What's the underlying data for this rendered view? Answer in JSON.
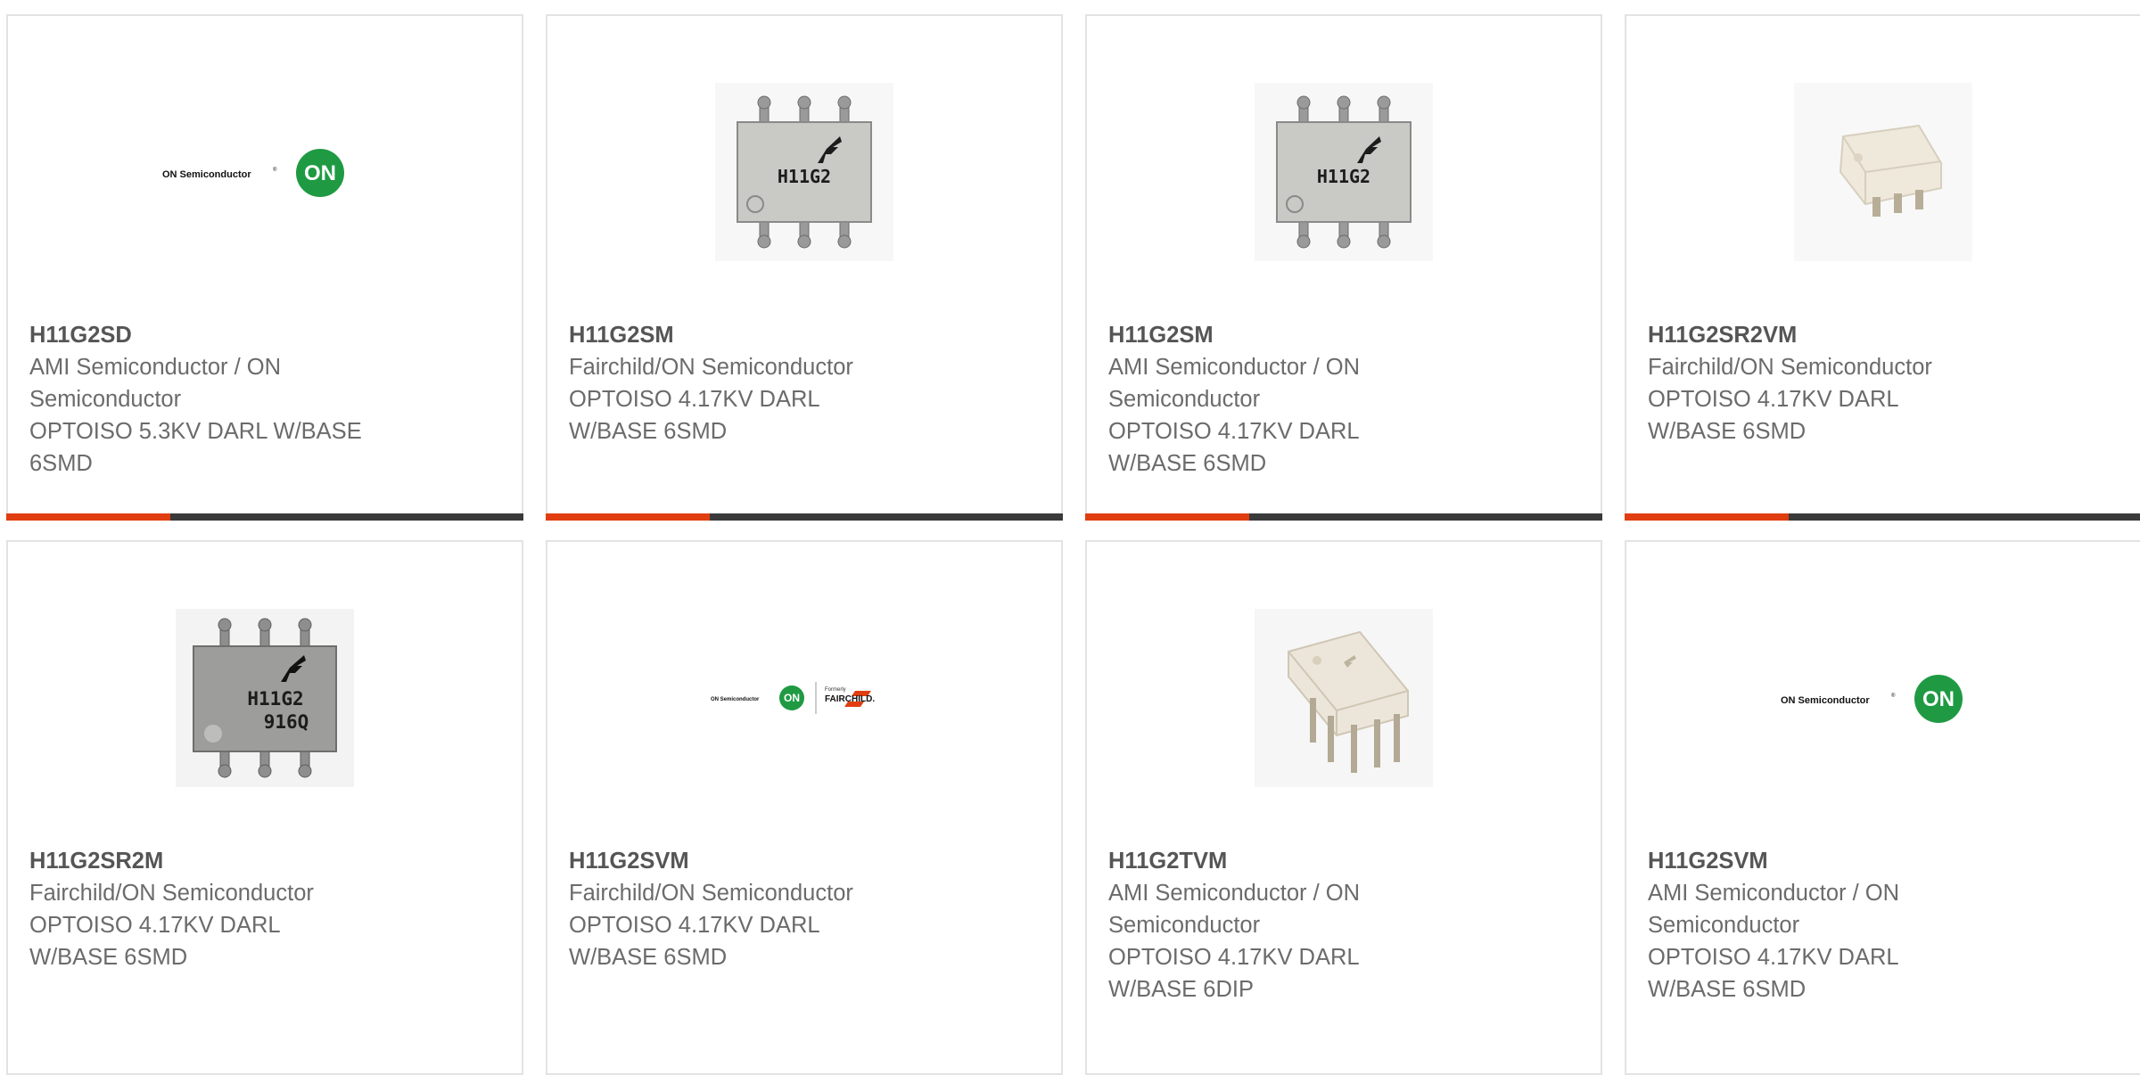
{
  "products": [
    {
      "part": "H11G2SD",
      "manufacturer": "AMI Semiconductor / ON Semiconductor",
      "mfr_lines": [
        "AMI Semiconductor / ON",
        "Semiconductor"
      ],
      "description": "OPTOISO 5.3KV DARL W/BASE 6SMD",
      "desc_lines": [
        "OPTOISO 5.3KV DARL W/BASE",
        "6SMD"
      ],
      "image": "on-semiconductor-logo",
      "logo_text": "ON Semiconductor",
      "logo_badge": "ON"
    },
    {
      "part": "H11G2SM",
      "manufacturer": "Fairchild/ON Semiconductor",
      "mfr_lines": [
        "Fairchild/ON Semiconductor"
      ],
      "description": "OPTOISO 4.17KV DARL W/BASE 6SMD",
      "desc_lines": [
        "OPTOISO 4.17KV DARL",
        "W/BASE 6SMD"
      ],
      "image": "chip-smd-topview",
      "chip_marking": [
        "H11G2"
      ]
    },
    {
      "part": "H11G2SM",
      "manufacturer": "AMI Semiconductor / ON Semiconductor",
      "mfr_lines": [
        "AMI Semiconductor / ON",
        "Semiconductor"
      ],
      "description": "OPTOISO 4.17KV DARL W/BASE 6SMD",
      "desc_lines": [
        "OPTOISO 4.17KV DARL",
        "W/BASE 6SMD"
      ],
      "image": "chip-smd-topview",
      "chip_marking": [
        "H11G2"
      ]
    },
    {
      "part": "H11G2SR2VM",
      "manufacturer": "Fairchild/ON Semiconductor",
      "mfr_lines": [
        "Fairchild/ON Semiconductor"
      ],
      "description": "OPTOISO 4.17KV DARL W/BASE 6SMD",
      "desc_lines": [
        "OPTOISO 4.17KV DARL",
        "W/BASE 6SMD"
      ],
      "image": "chip-smd-white"
    },
    {
      "part": "H11G2SR2M",
      "manufacturer": "Fairchild/ON Semiconductor",
      "mfr_lines": [
        "Fairchild/ON Semiconductor"
      ],
      "description": "OPTOISO 4.17KV DARL W/BASE 6SMD",
      "desc_lines": [
        "OPTOISO 4.17KV DARL",
        "W/BASE 6SMD"
      ],
      "image": "chip-smd-dark",
      "chip_marking": [
        "H11G2",
        "916Q"
      ]
    },
    {
      "part": "H11G2SVM",
      "manufacturer": "Fairchild/ON Semiconductor",
      "mfr_lines": [
        "Fairchild/ON Semiconductor"
      ],
      "description": "OPTOISO 4.17KV DARL W/BASE 6SMD",
      "desc_lines": [
        "OPTOISO 4.17KV DARL",
        "W/BASE 6SMD"
      ],
      "image": "on-fairchild-logo",
      "logo_text": "ON Semiconductor",
      "logo_badge": "ON",
      "logo_formerly": "Formerly",
      "logo_fairchild": "FAIRCHILD."
    },
    {
      "part": "H11G2TVM",
      "manufacturer": "AMI Semiconductor / ON Semiconductor",
      "mfr_lines": [
        "AMI Semiconductor / ON",
        "Semiconductor"
      ],
      "description": "OPTOISO 4.17KV DARL W/BASE 6DIP",
      "desc_lines": [
        "OPTOISO 4.17KV DARL",
        "W/BASE 6DIP"
      ],
      "image": "chip-dip-white"
    },
    {
      "part": "H11G2SVM",
      "manufacturer": "AMI Semiconductor / ON Semiconductor",
      "mfr_lines": [
        "AMI Semiconductor / ON",
        "Semiconductor"
      ],
      "description": "OPTOISO 4.17KV DARL W/BASE 6SMD",
      "desc_lines": [
        "OPTOISO 4.17KV DARL",
        "W/BASE 6SMD"
      ],
      "image": "on-semiconductor-logo",
      "logo_text": "ON Semiconductor",
      "logo_badge": "ON"
    }
  ],
  "colors": {
    "accent": "#e03e10",
    "bar": "#3a3a3a",
    "border": "#e3e3e3",
    "on_green": "#1f9a43"
  }
}
